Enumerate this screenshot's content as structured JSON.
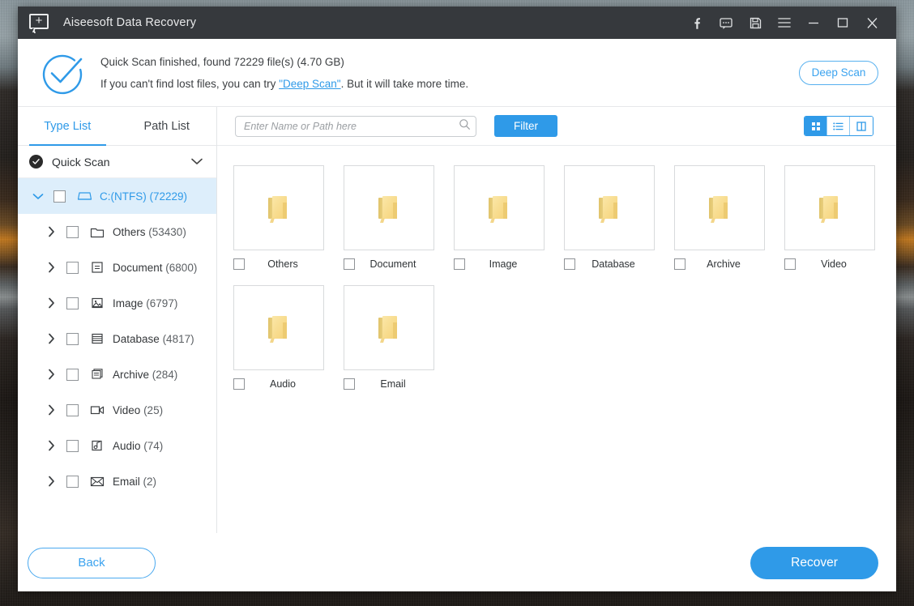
{
  "titlebar": {
    "app_title": "Aiseesoft Data Recovery",
    "logo_icon": "speech-bubble-plus-icon",
    "buttons": [
      {
        "name": "facebook-icon",
        "label": "f"
      },
      {
        "name": "feedback-icon",
        "label": ""
      },
      {
        "name": "save-register-icon",
        "label": ""
      },
      {
        "name": "menu-icon",
        "label": ""
      },
      {
        "name": "minimize-icon",
        "label": ""
      },
      {
        "name": "maximize-icon",
        "label": ""
      },
      {
        "name": "close-icon",
        "label": ""
      }
    ]
  },
  "status": {
    "icon": "circle-check-icon",
    "line1": "Quick Scan finished, found 72229 file(s) (4.70 GB)",
    "line2_before": "If you can't find lost files, you can try ",
    "line2_link": "\"Deep Scan\"",
    "line2_after": ". But it will take more time.",
    "deep_scan_button": "Deep Scan"
  },
  "sidebar": {
    "tabs": [
      {
        "label": "Type List",
        "active": true
      },
      {
        "label": "Path List",
        "active": false
      }
    ],
    "scan_mode": {
      "label": "Quick Scan",
      "check_icon": "check-circle-filled-icon",
      "chevron": "chevron-down-icon"
    },
    "root": {
      "label": "C:(NTFS)",
      "count": "(72229)",
      "icon": "hard-drive-icon",
      "expanded": true
    },
    "items": [
      {
        "label": "Others",
        "count": "(53430)",
        "icon": "folder-icon"
      },
      {
        "label": "Document",
        "count": "(6800)",
        "icon": "document-icon"
      },
      {
        "label": "Image",
        "count": "(6797)",
        "icon": "image-icon"
      },
      {
        "label": "Database",
        "count": "(4817)",
        "icon": "database-icon"
      },
      {
        "label": "Archive",
        "count": "(284)",
        "icon": "archive-icon"
      },
      {
        "label": "Video",
        "count": "(25)",
        "icon": "video-icon"
      },
      {
        "label": "Audio",
        "count": "(74)",
        "icon": "audio-icon"
      },
      {
        "label": "Email",
        "count": "(2)",
        "icon": "email-icon"
      }
    ]
  },
  "toolbar": {
    "search_placeholder": "Enter Name or Path here",
    "search_value": "",
    "search_icon": "search-icon",
    "filter_label": "Filter",
    "views": [
      {
        "name": "grid-view-icon",
        "active": true
      },
      {
        "name": "list-view-icon",
        "active": false
      },
      {
        "name": "detail-view-icon",
        "active": false
      }
    ]
  },
  "grid": {
    "tiles": [
      {
        "label": "Others",
        "icon": "folder-icon",
        "checked": false
      },
      {
        "label": "Document",
        "icon": "folder-icon",
        "checked": false
      },
      {
        "label": "Image",
        "icon": "folder-icon",
        "checked": false
      },
      {
        "label": "Database",
        "icon": "folder-icon",
        "checked": false
      },
      {
        "label": "Archive",
        "icon": "folder-icon",
        "checked": false
      },
      {
        "label": "Video",
        "icon": "folder-icon",
        "checked": false
      },
      {
        "label": "Audio",
        "icon": "folder-icon",
        "checked": false
      },
      {
        "label": "Email",
        "icon": "folder-icon",
        "checked": false
      }
    ]
  },
  "footer": {
    "back_label": "Back",
    "recover_label": "Recover"
  },
  "colors": {
    "accent": "#2f9ae8",
    "titlebar": "#36393d",
    "selection": "#ddeefb",
    "folder": "#f5d277"
  }
}
